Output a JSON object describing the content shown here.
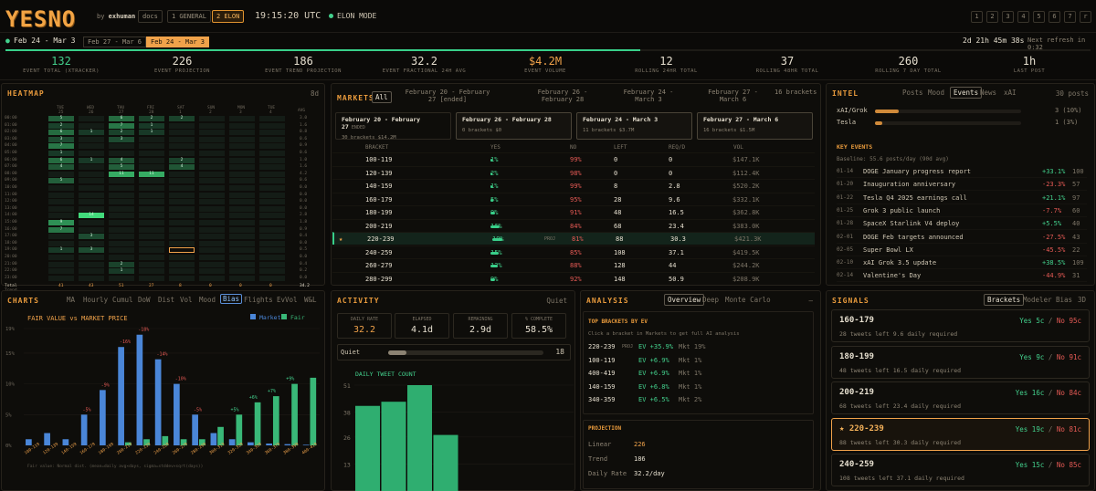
{
  "header": {
    "logo": "YESNO",
    "by_prefix": "by",
    "by_author": "exhuman",
    "docs_label": "docs",
    "tabs": [
      {
        "label": "1 GENERAL",
        "active": false
      },
      {
        "label": "2 ELON",
        "active": true
      }
    ],
    "clock": "19:15:20 UTC",
    "mode": "ELON MODE",
    "num_keys": [
      "1",
      "2",
      "3",
      "4",
      "5",
      "6",
      "7",
      "r"
    ]
  },
  "range": {
    "current": "Feb 24 - Mar 3",
    "pills": [
      {
        "label": "Feb 27 - Mar 6",
        "active": false
      },
      {
        "label": "Feb 24 - Mar 3",
        "active": true
      }
    ],
    "countdown": "2d 21h 45m 38s",
    "refresh": "Next refresh in 0:32",
    "progress": 0.585
  },
  "stats": [
    {
      "value": "132",
      "label": "EVENT TOTAL (XTRACKER)",
      "color": "#43d18d"
    },
    {
      "value": "226",
      "label": "EVENT PROJECTION",
      "color": "#e6dfcf"
    },
    {
      "value": "186",
      "label": "EVENT TREND PROJECTION",
      "color": "#e6dfcf"
    },
    {
      "value": "32.2",
      "label": "EVENT FRACTIONAL 24H AVG",
      "color": "#e6dfcf"
    },
    {
      "value": "$4.2M",
      "label": "EVENT VOLUME",
      "color": "#f0a24a"
    },
    {
      "value": "12",
      "label": "ROLLING 24HR TOTAL",
      "color": "#e6dfcf"
    },
    {
      "value": "37",
      "label": "ROLLING 48HR TOTAL",
      "color": "#e6dfcf"
    },
    {
      "value": "260",
      "label": "ROLLING 7 DAY TOTAL",
      "color": "#e6dfcf"
    },
    {
      "value": "1h",
      "label": "LAST POST",
      "color": "#e6dfcf"
    }
  ],
  "heatmap": {
    "title": "HEATMAP",
    "badge": "8d",
    "days": [
      "TUE 25",
      "WED 26",
      "THU 27",
      "FRI 28",
      "SAT 1",
      "SUN 2",
      "MON 3",
      "TUE 4"
    ],
    "avg_label": "AVG",
    "hours": [
      "00:00",
      "01:00",
      "02:00",
      "03:00",
      "04:00",
      "05:00",
      "06:00",
      "07:00",
      "08:00",
      "09:00",
      "10:00",
      "11:00",
      "12:00",
      "13:00",
      "14:00",
      "15:00",
      "16:00",
      "17:00",
      "18:00",
      "19:00",
      "20:00",
      "21:00",
      "22:00",
      "23:00"
    ],
    "cells": [
      [
        5,
        0,
        6,
        2,
        2,
        0,
        0,
        0
      ],
      [
        2,
        0,
        7,
        1,
        0,
        0,
        0,
        0
      ],
      [
        6,
        1,
        2,
        1,
        0,
        0,
        0,
        0
      ],
      [
        3,
        0,
        3,
        0,
        0,
        0,
        0,
        0
      ],
      [
        7,
        0,
        0,
        0,
        0,
        0,
        0,
        0
      ],
      [
        1,
        0,
        0,
        0,
        0,
        0,
        0,
        0
      ],
      [
        6,
        1,
        4,
        0,
        2,
        0,
        0,
        0
      ],
      [
        4,
        0,
        5,
        0,
        4,
        0,
        0,
        0
      ],
      [
        0,
        0,
        11,
        11,
        0,
        0,
        0,
        0
      ],
      [
        5,
        0,
        0,
        0,
        0,
        0,
        0,
        0
      ],
      [
        0,
        0,
        0,
        0,
        0,
        0,
        0,
        0
      ],
      [
        0,
        0,
        0,
        0,
        0,
        0,
        0,
        0
      ],
      [
        0,
        0,
        0,
        0,
        0,
        0,
        0,
        0
      ],
      [
        0,
        0,
        0,
        0,
        0,
        0,
        0,
        0
      ],
      [
        0,
        14,
        0,
        0,
        0,
        0,
        0,
        0
      ],
      [
        9,
        0,
        0,
        0,
        0,
        0,
        0,
        0
      ],
      [
        7,
        0,
        0,
        0,
        0,
        0,
        0,
        0
      ],
      [
        0,
        3,
        0,
        0,
        0,
        0,
        0,
        0
      ],
      [
        0,
        0,
        0,
        0,
        0,
        0,
        0,
        0
      ],
      [
        1,
        3,
        0,
        0,
        0,
        0,
        0,
        0
      ],
      [
        0,
        0,
        0,
        0,
        0,
        0,
        0,
        0
      ],
      [
        0,
        0,
        2,
        0,
        0,
        0,
        0,
        0
      ],
      [
        0,
        0,
        1,
        0,
        0,
        0,
        0,
        0
      ],
      [
        0,
        0,
        0,
        0,
        0,
        0,
        0,
        0
      ]
    ],
    "avg": [
      "3.0",
      "1.6",
      "0.8",
      "0.6",
      "0.9",
      "0.6",
      "1.0",
      "1.6",
      "4.2",
      "0.6",
      "0.0",
      "0.0",
      "0.0",
      "0.0",
      "2.8",
      "1.8",
      "0.9",
      "0.4",
      "0.0",
      "0.5",
      "0.0",
      "0.4",
      "0.2",
      "0.0"
    ],
    "total_label": "Total",
    "totals": [
      "41",
      "43",
      "51",
      "27",
      "8",
      "0",
      "0",
      "0"
    ],
    "total_avg": "34.2",
    "trend_label": "Trend"
  },
  "markets": {
    "title": "MARKETS",
    "all_label": "All",
    "tabs": [
      "February 20 - February 27 [ended]",
      "February 26 - February 28",
      "February 24 - March 3",
      "February 27 - March 6"
    ],
    "bracket_count": "16 brackets",
    "cards": [
      {
        "title": "February 20 - February 27",
        "tag": "ENDED",
        "sub": "30 brackets  $14.2M"
      },
      {
        "title": "February 26 - February 28",
        "tag": "",
        "sub": "0 brackets  $0"
      },
      {
        "title": "February 24 - March 3",
        "tag": "",
        "sub": "11 brackets  $3.7M"
      },
      {
        "title": "February 27 - March 6",
        "tag": "",
        "sub": "16 brackets  $1.5M"
      }
    ],
    "columns": [
      "BRACKET",
      "YES",
      "NO",
      "LEFT",
      "REQ/D",
      "VOL"
    ],
    "rows": [
      {
        "bracket": "100-119",
        "yes": "1%",
        "yes_val": 1,
        "no": "99%",
        "left": "0",
        "req": "0",
        "vol": "$147.1K",
        "proj": false
      },
      {
        "bracket": "120-139",
        "yes": "2%",
        "yes_val": 2,
        "no": "98%",
        "left": "0",
        "req": "0",
        "vol": "$112.4K",
        "proj": false
      },
      {
        "bracket": "140-159",
        "yes": "1%",
        "yes_val": 1,
        "no": "99%",
        "left": "8",
        "req": "2.8",
        "vol": "$520.2K",
        "proj": false
      },
      {
        "bracket": "160-179",
        "yes": "5%",
        "yes_val": 5,
        "no": "95%",
        "left": "28",
        "req": "9.6",
        "vol": "$332.1K",
        "proj": false
      },
      {
        "bracket": "180-199",
        "yes": "9%",
        "yes_val": 9,
        "no": "91%",
        "left": "48",
        "req": "16.5",
        "vol": "$362.8K",
        "proj": false
      },
      {
        "bracket": "200-219",
        "yes": "16%",
        "yes_val": 16,
        "no": "84%",
        "left": "68",
        "req": "23.4",
        "vol": "$383.0K",
        "proj": false
      },
      {
        "bracket": "220-239",
        "yes": "19%",
        "yes_val": 19,
        "no": "81%",
        "left": "88",
        "req": "30.3",
        "vol": "$421.3K",
        "proj": true
      },
      {
        "bracket": "240-259",
        "yes": "15%",
        "yes_val": 15,
        "no": "85%",
        "left": "108",
        "req": "37.1",
        "vol": "$419.5K",
        "proj": false
      },
      {
        "bracket": "260-279",
        "yes": "13%",
        "yes_val": 13,
        "no": "88%",
        "left": "128",
        "req": "44",
        "vol": "$244.2K",
        "proj": false
      },
      {
        "bracket": "280-299",
        "yes": "9%",
        "yes_val": 9,
        "no": "92%",
        "left": "148",
        "req": "50.9",
        "vol": "$208.9K",
        "proj": false
      }
    ],
    "proj_tag": "PROJ"
  },
  "intel": {
    "title": "INTEL",
    "tabs": [
      "Posts",
      "Mood",
      "Events",
      "News",
      "xAI"
    ],
    "active_tab": "Events",
    "count": "30 posts",
    "topics": [
      {
        "name": "xAI/Grok",
        "val": "3 (10%)",
        "frac": 0.1
      },
      {
        "name": "Tesla",
        "val": "1 (3%)",
        "frac": 0.03
      }
    ],
    "key_events_title": "KEY EVENTS",
    "baseline": "Baseline: 55.6 posts/day (90d avg)",
    "events": [
      {
        "date": "01-14",
        "name": "DOGE January progress report",
        "pct": "+33.1%",
        "n": "100"
      },
      {
        "date": "01-20",
        "name": "Inauguration anniversary",
        "pct": "-23.3%",
        "n": "57"
      },
      {
        "date": "01-22",
        "name": "Tesla Q4 2025 earnings call",
        "pct": "+21.1%",
        "n": "97"
      },
      {
        "date": "01-25",
        "name": "Grok 3 public launch",
        "pct": "-7.7%",
        "n": "60"
      },
      {
        "date": "01-28",
        "name": "SpaceX Starlink V4 deploy",
        "pct": "+5.5%",
        "n": "40"
      },
      {
        "date": "02-01",
        "name": "DOGE Feb targets announced",
        "pct": "-27.5%",
        "n": "43"
      },
      {
        "date": "02-05",
        "name": "Super Bowl LX",
        "pct": "-45.5%",
        "n": "22"
      },
      {
        "date": "02-10",
        "name": "xAI Grok 3.5 update",
        "pct": "+38.5%",
        "n": "109"
      },
      {
        "date": "02-14",
        "name": "Valentine's Day",
        "pct": "-44.9%",
        "n": "31"
      }
    ]
  },
  "charts": {
    "title": "CHARTS",
    "tabs": [
      "MA",
      "Hourly",
      "Cumul",
      "DoW",
      "Dist",
      "Vol",
      "Mood",
      "Bias",
      "Flights",
      "EvVol",
      "W&L"
    ],
    "active_tab": "Bias",
    "footnote": "Fair value: Normal dist. (mean=daily avg×days, sigma=stddev×sqrt(days))"
  },
  "chart_data": {
    "type": "bar",
    "title": "FAIR VALUE vs MARKET PRICE",
    "series": [
      {
        "name": "Market",
        "color": "#4a86d8",
        "values": [
          1,
          2,
          1,
          5,
          9,
          16,
          18,
          14,
          10,
          5,
          2,
          1,
          0.5,
          0.3,
          0.2,
          0.1
        ]
      },
      {
        "name": "Fair",
        "color": "#39b878",
        "values": [
          0,
          0,
          0,
          0,
          0,
          0.5,
          1,
          1.5,
          1,
          1,
          3,
          5,
          7,
          8,
          10,
          11
        ]
      }
    ],
    "categories": [
      "100-119",
      "120-139",
      "140-159",
      "160-179",
      "180-199",
      "200-219",
      "220-239",
      "240-259",
      "260-279",
      "280-299",
      "300-319",
      "320-339",
      "340-359",
      "360-379",
      "380-399",
      "400-419"
    ],
    "diff_labels": [
      "",
      "",
      "",
      "-5%",
      "-9%",
      "-16%",
      "-18%",
      "-14%",
      "-10%",
      "-5%",
      "",
      "+5%",
      "+6%",
      "+7%",
      "+9%",
      ""
    ],
    "yticks": [
      "0%",
      "5%",
      "10%",
      "15%",
      "19%"
    ],
    "ylim": [
      0,
      19
    ]
  },
  "activity": {
    "title": "ACTIVITY",
    "mood": "Quiet",
    "boxes": [
      {
        "label": "DAILY RATE",
        "value": "32.2",
        "color": "#f0a24a"
      },
      {
        "label": "ELAPSED",
        "value": "4.1d",
        "color": "#e6dfcf"
      },
      {
        "label": "REMAINING",
        "value": "2.9d",
        "color": "#e6dfcf"
      },
      {
        "label": "% COMPLETE",
        "value": "58.5%",
        "color": "#e6dfcf"
      }
    ],
    "quiet_label": "Quiet",
    "quiet_value": "18",
    "quiet_frac": 0.12,
    "tweet_title": "DAILY TWEET COUNT",
    "tweet_yticks": [
      "51",
      "38",
      "26",
      "13"
    ],
    "tweet_counts": [
      41,
      43,
      51,
      27
    ]
  },
  "analysis": {
    "title": "ANALYSIS",
    "tabs": [
      "Overview",
      "Deep",
      "Monte Carlo"
    ],
    "active_tab": "Overview",
    "collapse": "—",
    "ev_title": "TOP BRACKETS BY EV",
    "hint": "Click a bracket in Markets to get full AI analysis",
    "ev_rows": [
      {
        "bracket": "220-239",
        "tag": "PROJ",
        "ev": "EV +35.9%",
        "mkt": "Mkt 19%"
      },
      {
        "bracket": "100-119",
        "tag": "",
        "ev": "EV +6.9%",
        "mkt": "Mkt 1%"
      },
      {
        "bracket": "400-419",
        "tag": "",
        "ev": "EV +6.9%",
        "mkt": "Mkt 1%"
      },
      {
        "bracket": "140-159",
        "tag": "",
        "ev": "EV +6.8%",
        "mkt": "Mkt 1%"
      },
      {
        "bracket": "340-359",
        "tag": "",
        "ev": "EV +6.5%",
        "mkt": "Mkt 2%"
      }
    ],
    "proj_title": "PROJECTION",
    "projection": [
      {
        "label": "Linear",
        "value": "226",
        "color": "#f0a24a"
      },
      {
        "label": "Trend",
        "value": "186",
        "color": "#e6dfcf"
      },
      {
        "label": "Daily Rate",
        "value": "32.2/day",
        "color": "#e6dfcf"
      }
    ]
  },
  "signals": {
    "title": "SIGNALS",
    "tabs": [
      "Brackets",
      "Modeler",
      "Bias",
      "3D"
    ],
    "active_tab": "Brackets",
    "cards": [
      {
        "bracket": "160-179",
        "yes": "Yes 5c",
        "no": "No 95c",
        "detail": "28 tweets left  9.6 daily required",
        "selected": false
      },
      {
        "bracket": "180-199",
        "yes": "Yes 9c",
        "no": "No 91c",
        "detail": "48 tweets left  16.5 daily required",
        "selected": false
      },
      {
        "bracket": "200-219",
        "yes": "Yes 16c",
        "no": "No 84c",
        "detail": "68 tweets left  23.4 daily required",
        "selected": false
      },
      {
        "bracket": "220-239",
        "yes": "Yes 19c",
        "no": "No 81c",
        "detail": "88 tweets left  30.3 daily required",
        "selected": true
      },
      {
        "bracket": "240-259",
        "yes": "Yes 15c",
        "no": "No 85c",
        "detail": "108 tweets left  37.1 daily required",
        "selected": false
      }
    ]
  }
}
